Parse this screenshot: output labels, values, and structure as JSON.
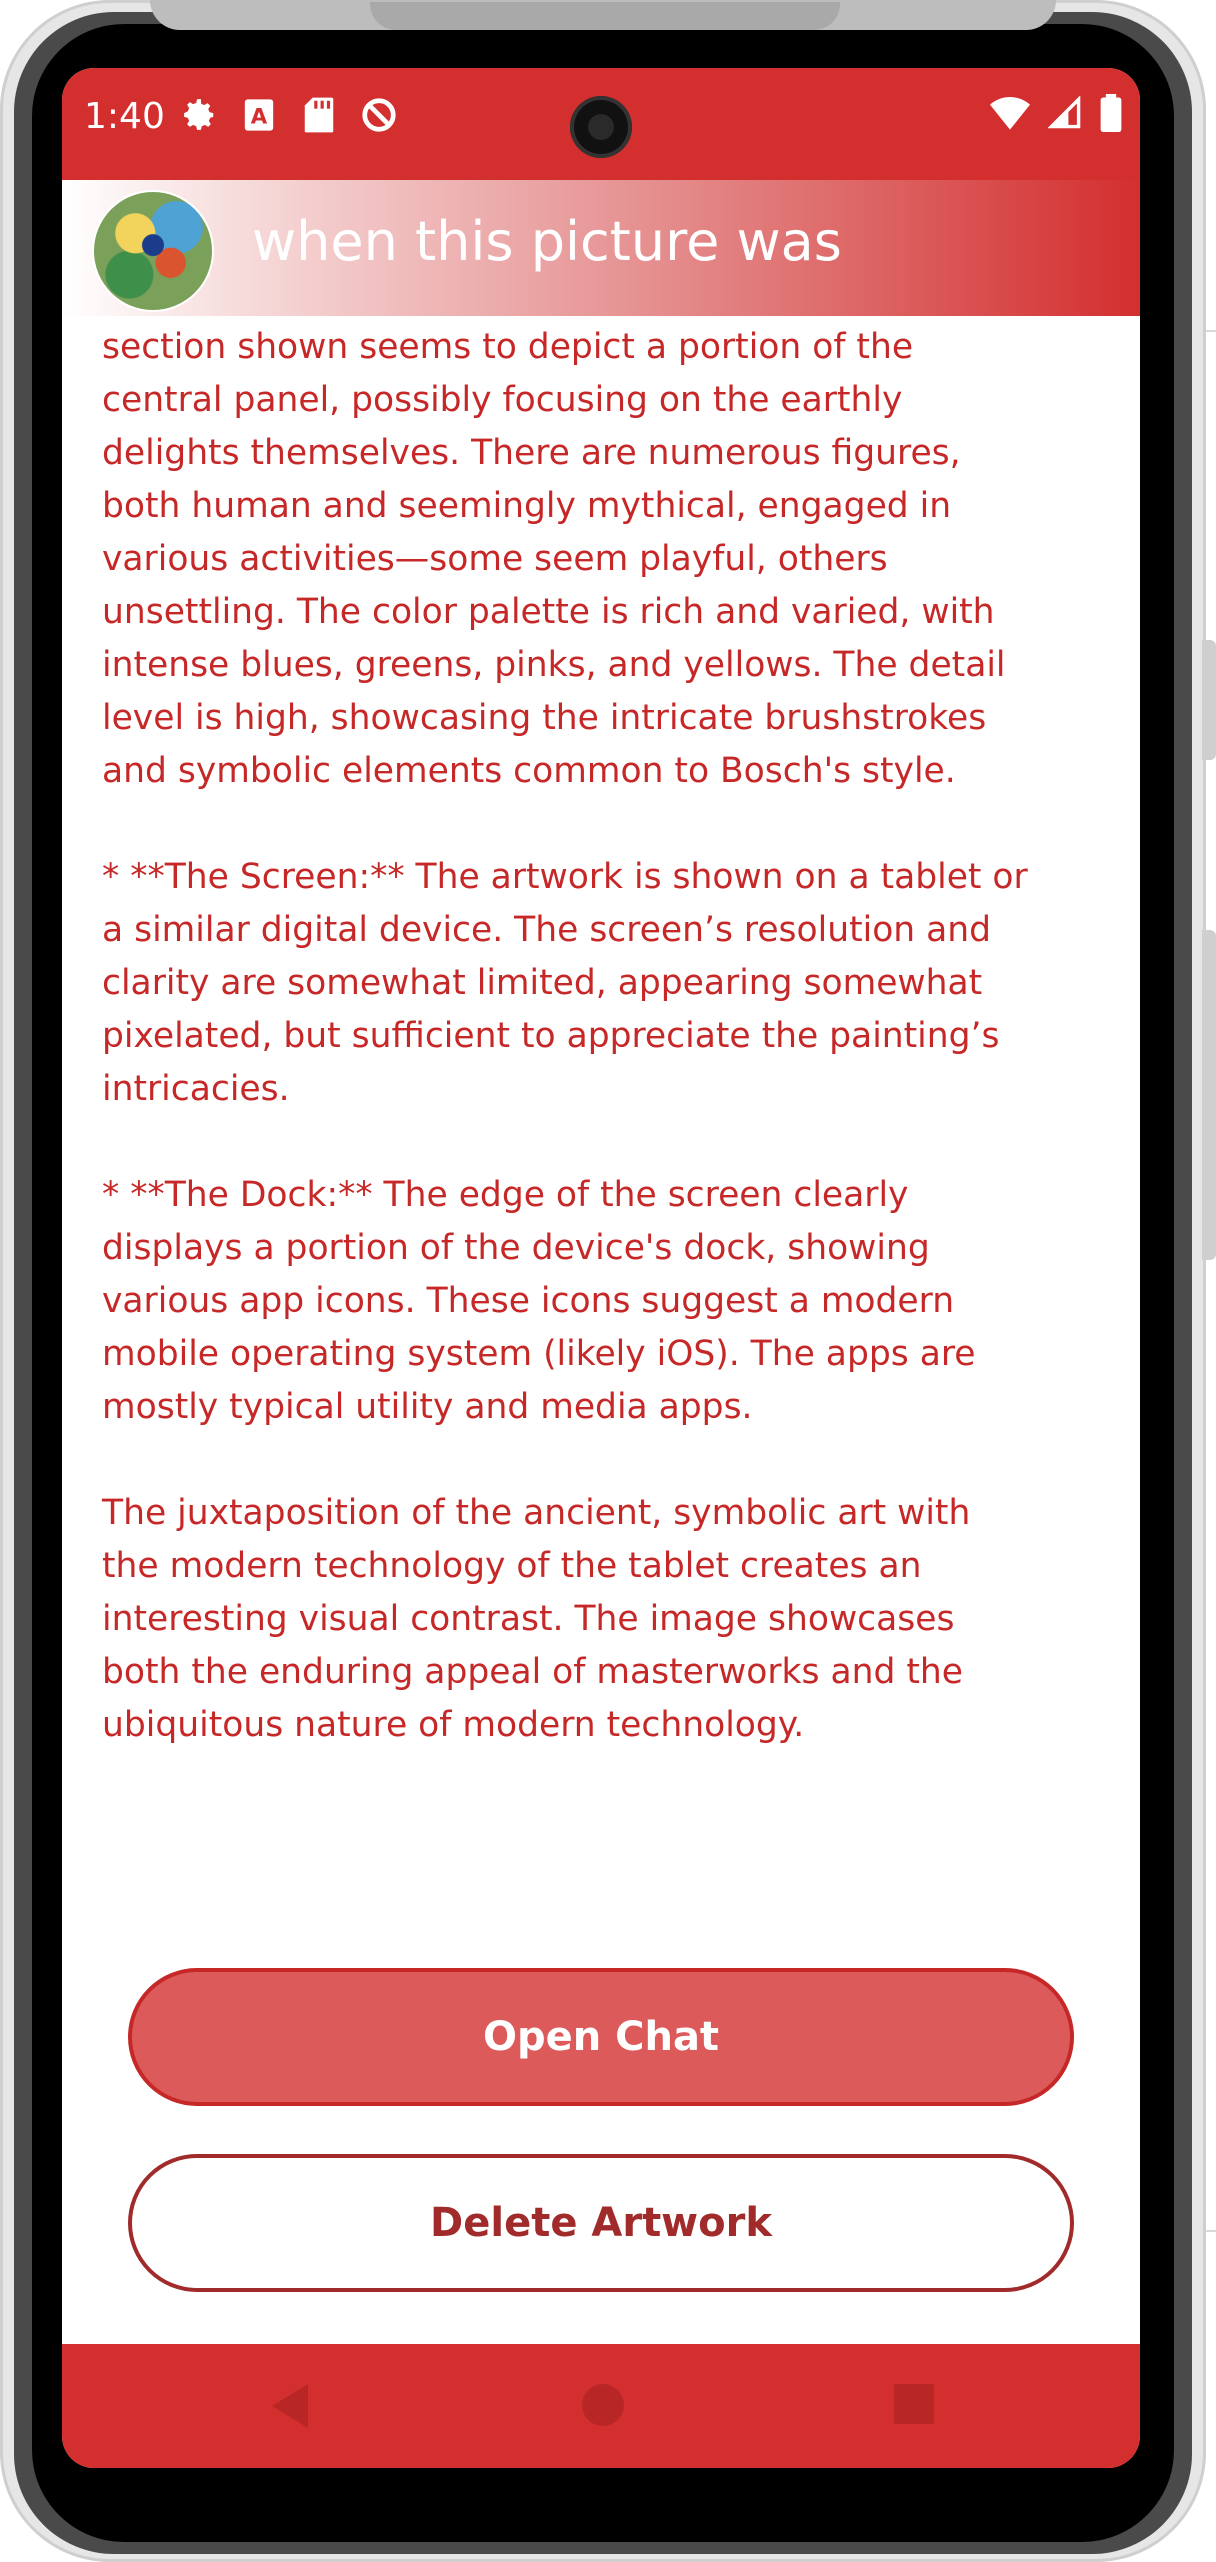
{
  "status_bar": {
    "time": "1:40",
    "left_icons": [
      "settings-icon",
      "a-icon",
      "sd-card-icon",
      "do-not-disturb-icon"
    ],
    "right_icons": [
      "wifi-icon",
      "cell-signal-icon",
      "battery-icon"
    ]
  },
  "header": {
    "title": "when this picture was",
    "avatar": "artwork-thumbnail"
  },
  "content": {
    "paragraphs": [
      "creatures, and bizarre landscapes. The specific\nsection shown seems to depict a portion of the\ncentral panel, possibly focusing on the earthly\ndelights themselves. There are numerous figures,\nboth human and seemingly mythical, engaged in\nvarious activities—some seem playful, others\nunsettling. The color palette is rich and varied, with\nintense blues, greens, pinks, and yellows. The detail\nlevel is high, showcasing the intricate brushstrokes\nand symbolic elements common to Bosch's style.",
      "* **The Screen:** The artwork is shown on a tablet or\na similar digital device. The screen’s resolution and\nclarity are somewhat limited, appearing somewhat\npixelated, but sufficient to appreciate the painting’s\nintricacies.",
      "* **The Dock:** The edge of the screen clearly\ndisplays a portion of the device's dock, showing\nvarious app icons. These icons suggest a modern\nmobile operating system (likely iOS).  The apps are\nmostly typical utility and media apps.",
      "The juxtaposition of the ancient, symbolic art with\nthe modern technology of the tablet creates an\ninteresting visual contrast. The image showcases\nboth the enduring appeal of masterworks and the\nubiquitous nature of modern technology."
    ]
  },
  "buttons": {
    "open_chat": "Open Chat",
    "delete_artwork": "Delete Artwork"
  },
  "nav": {
    "icons": [
      "back-icon",
      "home-icon",
      "recents-icon"
    ]
  },
  "colors": {
    "accent": "#d32f2f",
    "text": "#c62828",
    "button_fill": "#dc5a5a",
    "delete_text": "#a12a2a"
  }
}
